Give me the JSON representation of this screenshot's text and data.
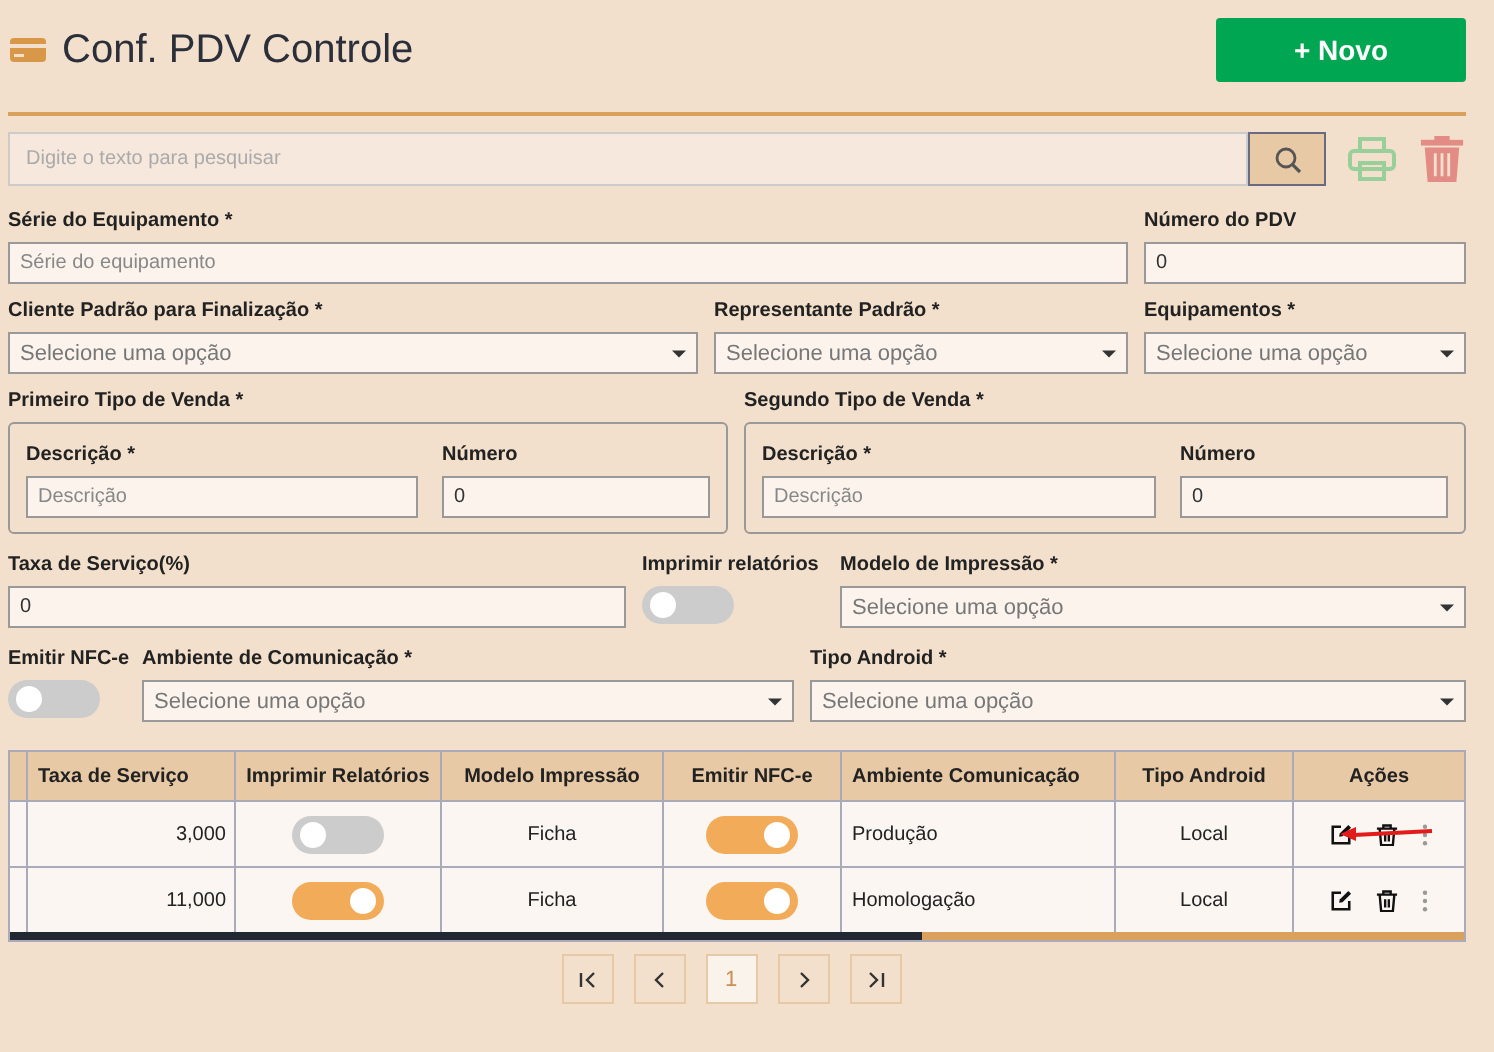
{
  "header": {
    "title": "Conf. PDV Controle",
    "new_button": "+ Novo"
  },
  "search": {
    "placeholder": "Digite o texto para pesquisar"
  },
  "form_rows": [
    [
      {
        "kind": "input",
        "label": "Série do Equipamento *",
        "placeholder": "Série do equipamento"
      },
      {
        "kind": "input",
        "label": "Número do PDV",
        "value": "0"
      }
    ],
    [
      {
        "kind": "select",
        "label": "Cliente Padrão para Finalização *",
        "placeholder": "Selecione uma opção"
      },
      {
        "kind": "select",
        "label": "Representante Padrão *",
        "placeholder": "Selecione uma opção"
      },
      {
        "kind": "select",
        "label": "Equipamentos *",
        "placeholder": "Selecione uma opção"
      }
    ],
    [
      {
        "kind": "group",
        "label": "Primeiro Tipo de Venda *",
        "fields": [
          {
            "label": "Descrição *",
            "placeholder": "Descrição"
          },
          {
            "label": "Número",
            "value": "0"
          }
        ]
      },
      {
        "kind": "group",
        "label": "Segundo Tipo de Venda *",
        "fields": [
          {
            "label": "Descrição *",
            "placeholder": "Descrição"
          },
          {
            "label": "Número",
            "value": "0"
          }
        ]
      }
    ],
    [
      {
        "kind": "input",
        "label": "Taxa de Serviço(%)",
        "value": "0"
      },
      {
        "kind": "toggle",
        "label": "Imprimir relatórios",
        "on": false
      },
      {
        "kind": "select",
        "label": "Modelo de Impressão *",
        "placeholder": "Selecione uma opção"
      }
    ],
    [
      {
        "kind": "toggle",
        "label": "Emitir NFC-e",
        "on": false
      },
      {
        "kind": "select",
        "label": "Ambiente de Comunicação *",
        "placeholder": "Selecione uma opção"
      },
      {
        "kind": "select",
        "label": "Tipo Android *",
        "placeholder": "Selecione uma opção"
      }
    ]
  ],
  "table": {
    "columns": [
      "Taxa de Serviço",
      "Imprimir Relatórios",
      "Modelo Impressão",
      "Emitir NFC-e",
      "Ambiente Comunicação",
      "Tipo Android",
      "Ações"
    ],
    "rows": [
      {
        "taxa": "3,000",
        "imprimir": false,
        "modelo": "Ficha",
        "emitir": true,
        "ambiente": "Produção",
        "tipo": "Local",
        "marked": true
      },
      {
        "taxa": "11,000",
        "imprimir": true,
        "modelo": "Ficha",
        "emitir": true,
        "ambiente": "Homologação",
        "tipo": "Local",
        "marked": false
      }
    ]
  },
  "pagination": {
    "pages": [
      {
        "label": "1",
        "selected": true
      }
    ]
  }
}
